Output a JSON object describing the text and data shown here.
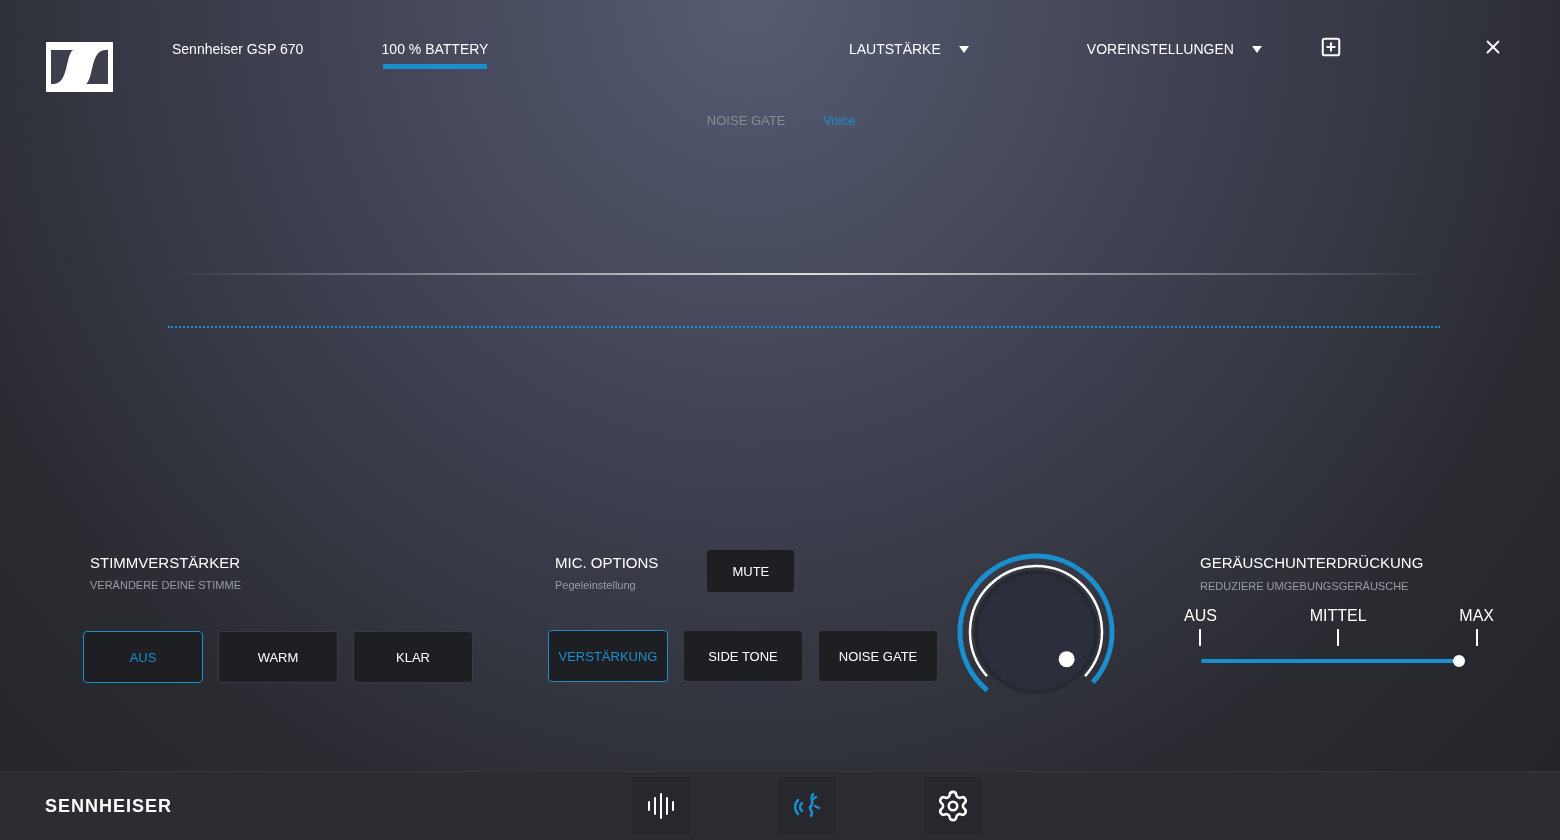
{
  "header": {
    "device": "Sennheiser GSP 670",
    "battery": {
      "label": "100 % BATTERY",
      "level": 1
    },
    "menus": [
      {
        "label": "LAUTSTÄRKE",
        "kind": "dropdown"
      },
      {
        "label": "VOREINSTELLUNGEN",
        "kind": "dropdown"
      }
    ]
  },
  "tabs": [
    {
      "label": "NOISE GATE",
      "selected": false
    },
    {
      "label": "Voice",
      "selected": true
    }
  ],
  "voice_enhancer": {
    "title": "STIMMVERSTÄRKER",
    "subtitle": "VERÄNDERE DEINE STIMME",
    "options": [
      {
        "label": "AUS",
        "selected": true
      },
      {
        "label": "WARM",
        "selected": false
      },
      {
        "label": "KLAR",
        "selected": false
      }
    ]
  },
  "mic_options": {
    "title": "MIC. OPTIONS",
    "subtitle": "Pegeleinstellung",
    "mute": "MUTE",
    "options": [
      {
        "label": "VERSTÄRKUNG",
        "selected": true
      },
      {
        "label": "SIDE TONE",
        "selected": false
      },
      {
        "label": "NOISE GATE",
        "selected": false
      }
    ],
    "knob": {
      "level": 0.97
    }
  },
  "noise_reduction": {
    "title": "GERÄUSCHUNTERDRÜCKUNG",
    "subtitle": "REDUZIERE UMGEBUNGSGERÄUSCHE",
    "marks": [
      "AUS",
      "MITTEL",
      "MAX"
    ],
    "level": 1
  },
  "footer": {
    "brand": "SENNHEISER",
    "nav": [
      {
        "kind": "equalizer",
        "selected": false
      },
      {
        "kind": "voice",
        "selected": true
      },
      {
        "kind": "settings",
        "selected": false
      }
    ]
  }
}
